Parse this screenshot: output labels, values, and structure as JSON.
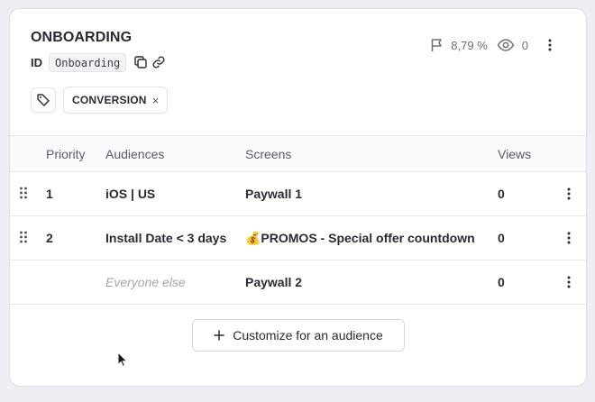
{
  "card": {
    "title": "ONBOARDING",
    "id_label": "ID",
    "id_value": "Onboarding",
    "stats": {
      "conversion": "8,79 %",
      "views": "0"
    },
    "tags": [
      {
        "label": "CONVERSION",
        "remove": "×"
      }
    ]
  },
  "table": {
    "headers": {
      "priority": "Priority",
      "audiences": "Audiences",
      "screens": "Screens",
      "views": "Views"
    },
    "rows": [
      {
        "priority": "1",
        "audience": "iOS | US",
        "screen": "Paywall 1",
        "views": "0"
      },
      {
        "priority": "2",
        "audience": "Install Date < 3 days",
        "screen": "💰PROMOS - Special offer countdown",
        "views": "0"
      },
      {
        "priority": "",
        "audience": "Everyone else",
        "screen": "Paywall 2",
        "views": "0"
      }
    ]
  },
  "footer": {
    "customize_label": "Customize for an audience"
  },
  "icons": {
    "copy": "copy-icon",
    "link": "link-icon",
    "tag": "tag-icon",
    "flag": "flag-icon",
    "eye": "eye-icon",
    "more": "more-vertical-icon",
    "drag": "drag-handle-icon",
    "plus": "plus-icon",
    "cursor": "mouse-cursor"
  }
}
